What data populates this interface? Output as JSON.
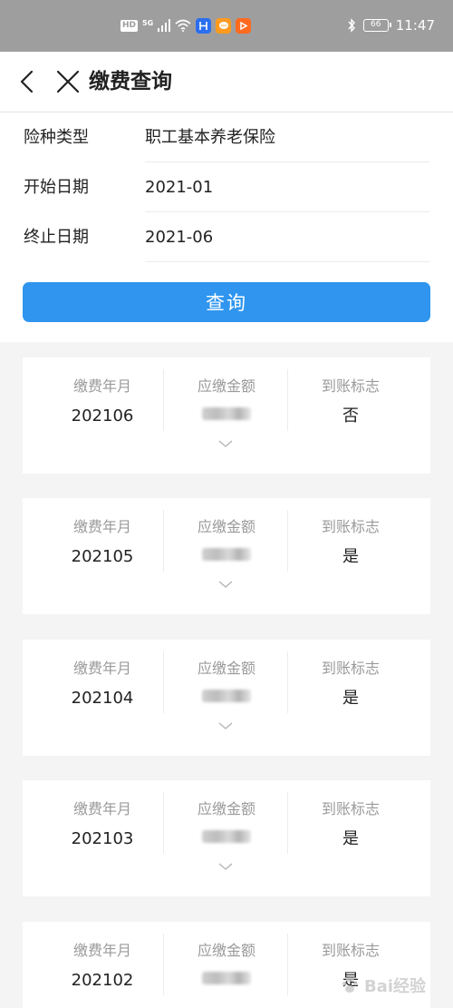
{
  "status_bar": {
    "network_hd": "HD",
    "network_5g": "5G",
    "battery_level": "66",
    "time": "11:47"
  },
  "header": {
    "title": "缴费查询"
  },
  "form": {
    "insurance_type_label": "险种类型",
    "insurance_type_value": "职工基本养老保险",
    "start_date_label": "开始日期",
    "start_date_value": "2021-01",
    "end_date_label": "终止日期",
    "end_date_value": "2021-06",
    "query_button": "查询"
  },
  "records": {
    "columns": {
      "month": "缴费年月",
      "amount": "应缴金额",
      "status": "到账标志"
    },
    "items": [
      {
        "month": "202106",
        "status": "否"
      },
      {
        "month": "202105",
        "status": "是"
      },
      {
        "month": "202104",
        "status": "是"
      },
      {
        "month": "202103",
        "status": "是"
      },
      {
        "month": "202102",
        "status": "是"
      }
    ]
  },
  "watermark": {
    "text": "Bai经验"
  },
  "colors": {
    "accent": "#2f95ef",
    "status_bar": "#9e9e9e",
    "background": "#f4f4f4"
  }
}
